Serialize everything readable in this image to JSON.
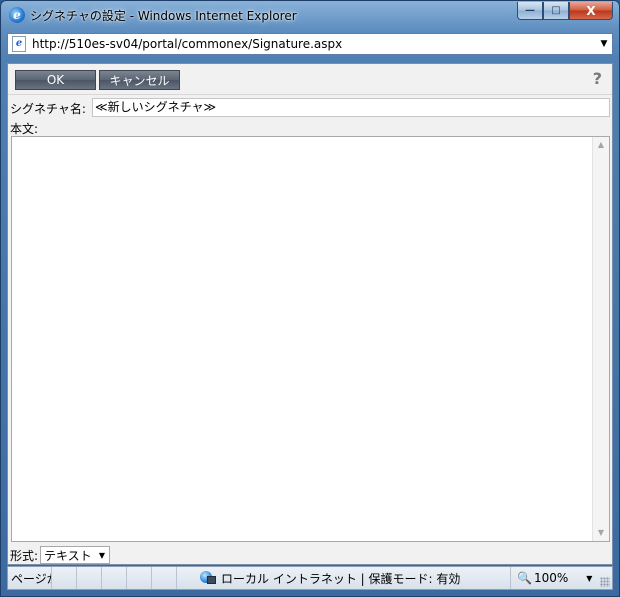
{
  "window": {
    "title": "シグネチャの設定 - Windows Internet Explorer",
    "controls": {
      "minimize": "—",
      "maximize": "□",
      "close": "X"
    }
  },
  "address": {
    "url": "http://510es-sv04/portal/commonex/Signature.aspx",
    "dropdown": "▼"
  },
  "toolbar": {
    "ok_label": "OK",
    "cancel_label": "キャンセル",
    "help": "?"
  },
  "form": {
    "name_label": "シグネチャ名:",
    "name_value": "≪新しいシグネチャ≫",
    "body_label": "本文:",
    "body_value": "",
    "format_label": "形式:",
    "format_value": "テキスト"
  },
  "statusbar": {
    "page_text": "ページが",
    "zone_text": "ローカル イントラネット | 保護モード: 有効",
    "zoom_text": "100%"
  },
  "icons": {
    "ie": "ie-logo-icon",
    "page": "page-icon",
    "zone": "intranet-zone-icon",
    "zoom": "zoom-icon"
  }
}
